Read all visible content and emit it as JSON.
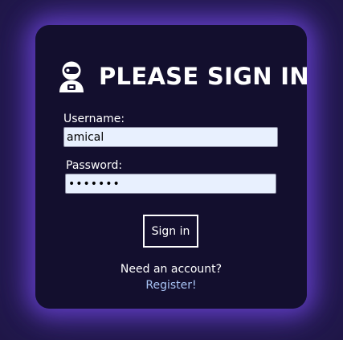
{
  "login": {
    "title": "PLEASE SIGN IN",
    "icon": "astronaut-icon",
    "username_label": "Username:",
    "username_value": "amical",
    "password_label": "Password:",
    "password_value": "•••••••",
    "signin_label": "Sign in",
    "need_account_text": "Need an account?",
    "register_link": "Register!"
  },
  "colors": {
    "page_background": "#1f1747",
    "card_background": "#130f2e",
    "glow": "#6e46dc",
    "input_background": "#e8f0fe",
    "link": "#a9c4f5",
    "text": "#ffffff"
  }
}
